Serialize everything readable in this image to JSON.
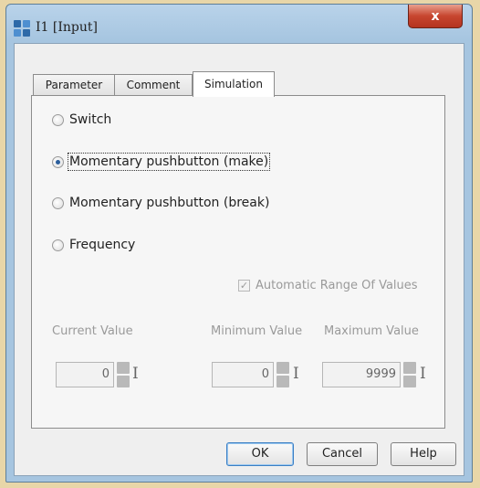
{
  "window": {
    "title": "I1 [Input]",
    "close_label": "x",
    "app_icon": "app-icon"
  },
  "tabs": [
    {
      "label": "Parameter",
      "active": false
    },
    {
      "label": "Comment",
      "active": false
    },
    {
      "label": "Simulation",
      "active": true
    }
  ],
  "simulation": {
    "options": [
      {
        "label": "Switch",
        "checked": false
      },
      {
        "label": "Momentary pushbutton (make)",
        "checked": true
      },
      {
        "label": "Momentary pushbutton (break)",
        "checked": false
      },
      {
        "label": "Frequency",
        "checked": false
      }
    ],
    "auto_range": {
      "label": "Automatic Range Of Values",
      "checked": true,
      "enabled": false
    },
    "current": {
      "label": "Current Value",
      "value": "0"
    },
    "minimum": {
      "label": "Minimum Value",
      "value": "0"
    },
    "maximum": {
      "label": "Maximum Value",
      "value": "9999"
    },
    "cursor_glyph": "I"
  },
  "buttons": {
    "ok": "OK",
    "cancel": "Cancel",
    "help": "Help"
  },
  "colors": {
    "selected_radio": "#2b5e9c",
    "close_button": "#c7452f",
    "window_frame": "#a6c5e0"
  }
}
